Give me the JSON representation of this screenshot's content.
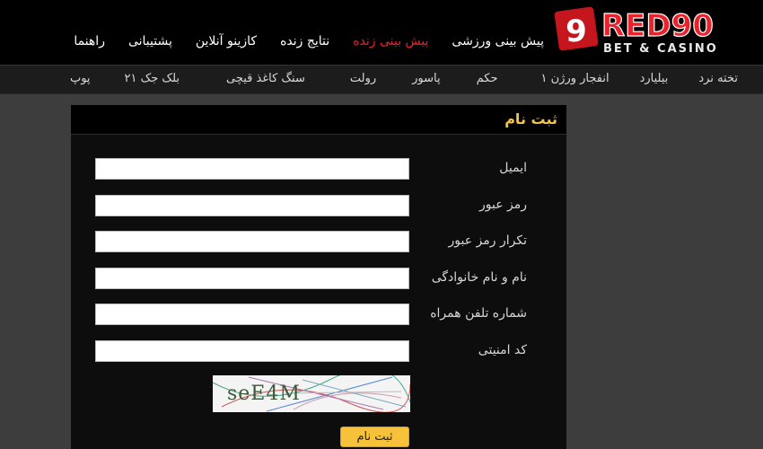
{
  "logo": {
    "brand": "RED90",
    "tagline": "BET & CASINO",
    "accent_color": "#e8232b"
  },
  "top_nav": [
    {
      "label": "پیش بینی ورزشی",
      "active": false
    },
    {
      "label": "پیش بینی زنده",
      "active": true
    },
    {
      "label": "نتایج زنده",
      "active": false
    },
    {
      "label": "کازینو آنلاین",
      "active": false
    },
    {
      "label": "پشتیبانی",
      "active": false
    },
    {
      "label": "راهنما",
      "active": false
    }
  ],
  "sub_nav": [
    "تخته نرد",
    "بیلیارد",
    "انفجار ورژن ۱",
    "حکم",
    "پاسور",
    "رولت",
    "سنگ کاغذ قیچی",
    "بلک جک ۲۱",
    "پوپ"
  ],
  "form": {
    "title": "ثبت نام",
    "fields": [
      {
        "label": "ایمیل",
        "value": ""
      },
      {
        "label": "رمز عبور",
        "value": ""
      },
      {
        "label": "تکرار رمز عبور",
        "value": ""
      },
      {
        "label": "نام و نام خانوادگی",
        "value": ""
      },
      {
        "label": "شماره تلفن همراه",
        "value": ""
      },
      {
        "label": "کد امنیتی",
        "value": ""
      }
    ],
    "captcha_text": "seE4M",
    "submit_label": "ثبت نام"
  }
}
